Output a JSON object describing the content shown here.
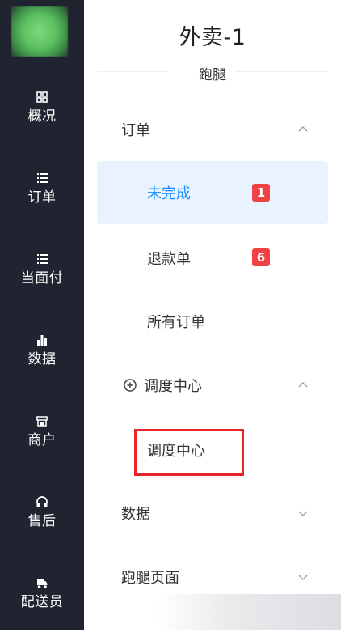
{
  "rail": {
    "items": [
      {
        "label": "概况",
        "icon": "grid-icon"
      },
      {
        "label": "订单",
        "icon": "list-icon"
      },
      {
        "label": "当面付",
        "icon": "list-icon"
      },
      {
        "label": "数据",
        "icon": "bar-chart-icon"
      },
      {
        "label": "商户",
        "icon": "store-icon"
      },
      {
        "label": "售后",
        "icon": "headset-icon"
      },
      {
        "label": "配送员",
        "icon": "delivery-icon"
      }
    ]
  },
  "panel": {
    "title": "外卖-1",
    "subtitle": "跑腿",
    "groups": {
      "orders": {
        "label": "订单",
        "items": [
          {
            "label": "未完成",
            "badge": "1"
          },
          {
            "label": "退款单",
            "badge": "6"
          },
          {
            "label": "所有订单"
          }
        ]
      },
      "dispatch": {
        "label": "调度中心",
        "icon": "plus-circle-icon",
        "items": [
          {
            "label": "调度中心"
          }
        ]
      },
      "data": {
        "label": "数据"
      },
      "errand_pages": {
        "label": "跑腿页面"
      }
    }
  },
  "colors": {
    "rail_bg": "#1f2430",
    "active_bg": "#e8f3ff",
    "active_text": "#1a8cff",
    "badge_bg": "#f04245",
    "highlight_border": "#e8252a"
  }
}
